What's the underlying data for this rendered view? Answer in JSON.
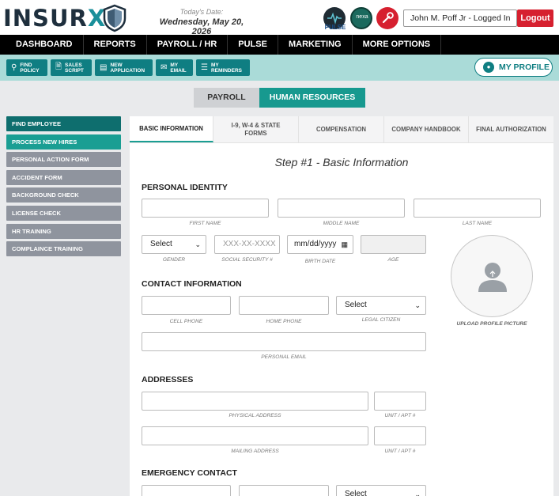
{
  "header": {
    "logo": "INSURX",
    "today_label": "Today's Date:",
    "today_date": "Wednesday, May 20, 2026",
    "pulse_label": "PULSE",
    "nexa_label": "nexa",
    "user": "John M. Poff Jr - Logged In",
    "logout": "Logout"
  },
  "nav": [
    "DASHBOARD",
    "REPORTS",
    "PAYROLL / HR",
    "PULSE",
    "MARKETING",
    "MORE OPTIONS"
  ],
  "toolbar": {
    "buttons": [
      {
        "l1": "FIND",
        "l2": "POLICY",
        "icon": "search-icon"
      },
      {
        "l1": "SALES",
        "l2": "SCRIPT",
        "icon": "document-icon"
      },
      {
        "l1": "NEW",
        "l2": "APPLICATION",
        "icon": "application-icon"
      },
      {
        "l1": "MY",
        "l2": "EMAIL",
        "icon": "email-icon"
      },
      {
        "l1": "MY",
        "l2": "REMINDERS",
        "icon": "checklist-icon"
      }
    ],
    "profile": "MY PROFILE"
  },
  "top_tabs": [
    "PAYROLL",
    "HUMAN RESOURCES"
  ],
  "sidebar": [
    "FIND EMPLOYEE",
    "PROCESS NEW HIRES",
    "PERSONAL ACTION FORM",
    "ACCIDENT FORM",
    "BACKGROUND CHECK",
    "LICENSE CHECK",
    "HR TRAINING",
    "COMPLAINCE TRAINING"
  ],
  "form_tabs": [
    {
      "line1": "BASIC INFORMATION",
      "line2": ""
    },
    {
      "line1": "I-9, W-4 & STATE",
      "line2": "FORMS"
    },
    {
      "line1": "COMPENSATION",
      "line2": ""
    },
    {
      "line1": "COMPANY HANDBOOK",
      "line2": ""
    },
    {
      "line1": "FINAL AUTHORIZATION",
      "line2": ""
    }
  ],
  "form": {
    "step_title": "Step #1 - Basic Information",
    "sections": {
      "identity": "PERSONAL IDENTITY",
      "contact": "CONTACT INFORMATION",
      "addresses": "ADDRESSES",
      "emergency": "EMERGENCY CONTACT"
    },
    "labels": {
      "first": "FIRST NAME",
      "middle": "MIDDLE NAME",
      "last": "LAST NAME",
      "gender": "GENDER",
      "ssn": "SOCIAL SECURITY #",
      "birth": "BIRTH DATE",
      "age": "AGE",
      "cell": "CELL PHONE",
      "home": "HOME PHONE",
      "citizen": "LEGAL CITIZEN",
      "email": "PERSONAL EMAIL",
      "physical": "PHYSICAL ADDRESS",
      "unit": "UNIT / APT #",
      "mailing": "MAILING ADDRESS",
      "upload": "UPLOAD PROFILE PICTURE"
    },
    "select_value": "Select",
    "ssn_placeholder": "XXX-XX-XXXX",
    "date_placeholder": "mm/dd/yyyy"
  }
}
